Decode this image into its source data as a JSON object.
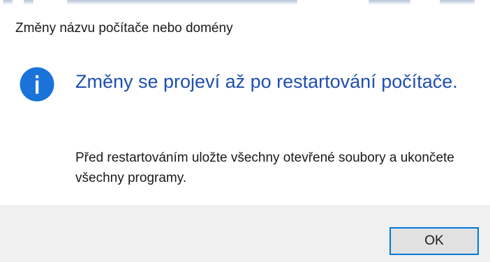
{
  "dialog": {
    "title": "Změny názvu počítače nebo domény",
    "icon": "information-icon",
    "main_instruction": "Změny se projeví až po restartování počítače.",
    "content": "Před restartováním uložte všechny otevřené soubory a ukončete všechny programy.",
    "ok_label": "OK"
  },
  "colors": {
    "accent": "#0078d7",
    "main_instruction": "#1f4fb0",
    "footer_bg": "#f0f0f0",
    "button_bg": "#e1e1e1"
  }
}
